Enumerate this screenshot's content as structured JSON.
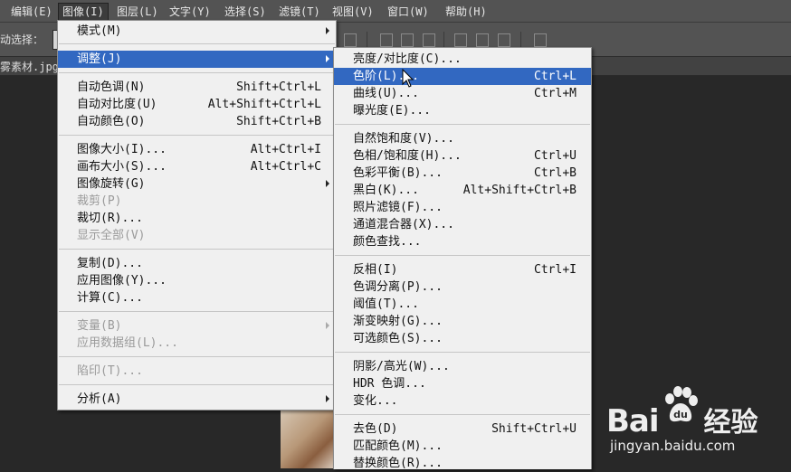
{
  "menubar": {
    "items": [
      {
        "label": "编辑(E)"
      },
      {
        "label": "图像(I)"
      },
      {
        "label": "图层(L)"
      },
      {
        "label": "文字(Y)"
      },
      {
        "label": "选择(S)"
      },
      {
        "label": "滤镜(T)"
      },
      {
        "label": "视图(V)"
      },
      {
        "label": "窗口(W)"
      },
      {
        "label": "帮助(H)"
      }
    ]
  },
  "optionbar": {
    "auto_select_label": "动选择："
  },
  "doc_tab": {
    "title": "雾素材.jpg"
  },
  "image_menu": {
    "items": [
      {
        "label": "模式(M)",
        "submenu": true
      },
      {
        "label": "调整(J)",
        "submenu": true,
        "highlighted": true
      },
      {
        "label": "自动色调(N)",
        "shortcut": "Shift+Ctrl+L"
      },
      {
        "label": "自动对比度(U)",
        "shortcut": "Alt+Shift+Ctrl+L"
      },
      {
        "label": "自动颜色(O)",
        "shortcut": "Shift+Ctrl+B"
      },
      {
        "label": "图像大小(I)...",
        "shortcut": "Alt+Ctrl+I"
      },
      {
        "label": "画布大小(S)...",
        "shortcut": "Alt+Ctrl+C"
      },
      {
        "label": "图像旋转(G)",
        "submenu": true
      },
      {
        "label": "裁剪(P)",
        "disabled": true
      },
      {
        "label": "裁切(R)..."
      },
      {
        "label": "显示全部(V)",
        "disabled": true
      },
      {
        "label": "复制(D)..."
      },
      {
        "label": "应用图像(Y)..."
      },
      {
        "label": "计算(C)..."
      },
      {
        "label": "变量(B)",
        "submenu": true,
        "disabled": true
      },
      {
        "label": "应用数据组(L)...",
        "disabled": true
      },
      {
        "label": "陷印(T)...",
        "disabled": true
      },
      {
        "label": "分析(A)",
        "submenu": true
      }
    ]
  },
  "adjust_menu": {
    "items": [
      {
        "label": "亮度/对比度(C)..."
      },
      {
        "label": "色阶(L)...",
        "shortcut": "Ctrl+L",
        "highlighted": true
      },
      {
        "label": "曲线(U)...",
        "shortcut": "Ctrl+M"
      },
      {
        "label": "曝光度(E)..."
      },
      {
        "label": "自然饱和度(V)..."
      },
      {
        "label": "色相/饱和度(H)...",
        "shortcut": "Ctrl+U"
      },
      {
        "label": "色彩平衡(B)...",
        "shortcut": "Ctrl+B"
      },
      {
        "label": "黑白(K)...",
        "shortcut": "Alt+Shift+Ctrl+B"
      },
      {
        "label": "照片滤镜(F)..."
      },
      {
        "label": "通道混合器(X)..."
      },
      {
        "label": "颜色查找..."
      },
      {
        "label": "反相(I)",
        "shortcut": "Ctrl+I"
      },
      {
        "label": "色调分离(P)..."
      },
      {
        "label": "阈值(T)..."
      },
      {
        "label": "渐变映射(G)..."
      },
      {
        "label": "可选颜色(S)..."
      },
      {
        "label": "阴影/高光(W)..."
      },
      {
        "label": "HDR 色调..."
      },
      {
        "label": "变化..."
      },
      {
        "label": "去色(D)",
        "shortcut": "Shift+Ctrl+U"
      },
      {
        "label": "匹配颜色(M)..."
      },
      {
        "label": "替换颜色(R)..."
      }
    ]
  },
  "watermark": {
    "logo_latin": "Bai",
    "logo_cn": "经验",
    "url": "jingyan.baidu.com"
  },
  "colors": {
    "highlight": "#3268c1",
    "menu_bg": "#f0f0f0",
    "chrome": "#535353",
    "workspace": "#282828"
  }
}
